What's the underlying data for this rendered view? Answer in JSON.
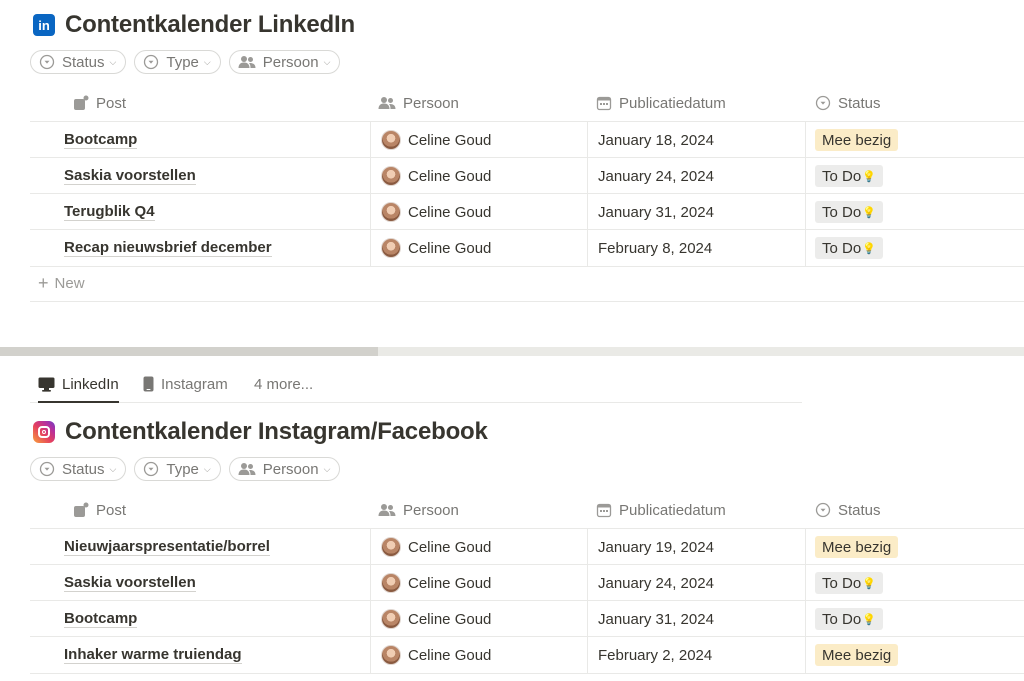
{
  "tabs": {
    "items": [
      {
        "label": "LinkedIn",
        "icon": "monitor-icon",
        "active": true
      },
      {
        "label": "Instagram",
        "icon": "phone-icon",
        "active": false
      }
    ],
    "more": "4 more..."
  },
  "filters": {
    "status": "Status",
    "type": "Type",
    "persoon": "Persoon"
  },
  "columns": {
    "post": "Post",
    "persoon": "Persoon",
    "datum": "Publicatiedatum",
    "status": "Status"
  },
  "linkedin": {
    "title": "Contentkalender LinkedIn",
    "logo_text": "in",
    "brand_color": "#0a66c2",
    "new_label": "New",
    "rows": [
      {
        "post": "Bootcamp",
        "person": "Celine Goud",
        "date": "January 18, 2024",
        "status": "Mee bezig"
      },
      {
        "post": "Saskia voorstellen",
        "person": "Celine Goud",
        "date": "January 24, 2024",
        "status": "To Do"
      },
      {
        "post": "Terugblik Q4",
        "person": "Celine Goud",
        "date": "January 31, 2024",
        "status": "To Do"
      },
      {
        "post": "Recap nieuwsbrief december",
        "person": "Celine Goud",
        "date": "February 8, 2024",
        "status": "To Do"
      }
    ]
  },
  "instagram": {
    "title": "Contentkalender Instagram/Facebook",
    "rows": [
      {
        "post": "Nieuwjaarspresentatie/borrel",
        "person": "Celine Goud",
        "date": "January 19, 2024",
        "status": "Mee bezig"
      },
      {
        "post": "Saskia voorstellen",
        "person": "Celine Goud",
        "date": "January 24, 2024",
        "status": "To Do"
      },
      {
        "post": "Bootcamp",
        "person": "Celine Goud",
        "date": "January 31, 2024",
        "status": "To Do"
      },
      {
        "post": "Inhaker warme truiendag",
        "person": "Celine Goud",
        "date": "February 2, 2024",
        "status": "Mee bezig"
      }
    ]
  },
  "status_colors": {
    "Mee bezig": "#fbecc7",
    "To Do": "#ececeb"
  }
}
